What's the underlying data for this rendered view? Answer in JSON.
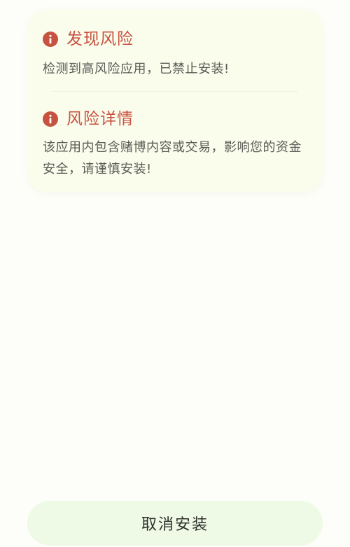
{
  "risk_card": {
    "found_risk": {
      "icon": "info-icon",
      "title": "发现风险",
      "description": "检测到高风险应用，已禁止安装!"
    },
    "risk_details": {
      "icon": "info-icon",
      "title": "风险详情",
      "description": "该应用内包含赌博内容或交易，影响您的资金安全，请谨慎安装!"
    }
  },
  "actions": {
    "cancel_label": "取消安装"
  },
  "colors": {
    "accent_red": "#c85240",
    "card_background": "#fafcec",
    "button_background": "#eefae5",
    "page_background": "#fdfef9"
  }
}
